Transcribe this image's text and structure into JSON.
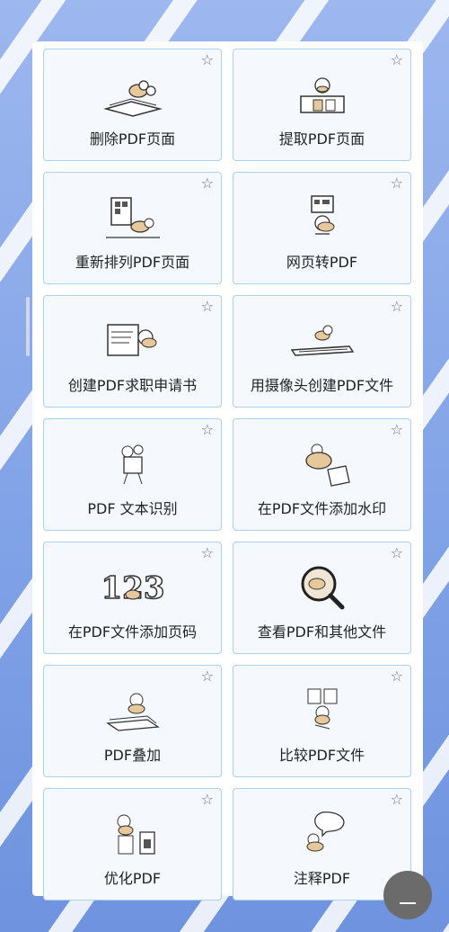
{
  "tools": [
    {
      "label": "删除PDF页面",
      "icon": "delete-pages-illustration"
    },
    {
      "label": "提取PDF页面",
      "icon": "extract-pages-illustration"
    },
    {
      "label": "重新排列PDF页面",
      "icon": "reorder-pages-illustration"
    },
    {
      "label": "网页转PDF",
      "icon": "web-to-pdf-illustration"
    },
    {
      "label": "创建PDF求职申请书",
      "icon": "resume-illustration"
    },
    {
      "label": "用摄像头创建PDF文件",
      "icon": "camera-scan-illustration"
    },
    {
      "label": "PDF 文本识别",
      "icon": "ocr-illustration"
    },
    {
      "label": "在PDF文件添加水印",
      "icon": "watermark-illustration"
    },
    {
      "label": "在PDF文件添加页码",
      "icon": "page-numbers-illustration"
    },
    {
      "label": "查看PDF和其他文件",
      "icon": "viewer-magnifier-illustration"
    },
    {
      "label": "PDF叠加",
      "icon": "overlay-illustration"
    },
    {
      "label": "比较PDF文件",
      "icon": "compare-illustration"
    },
    {
      "label": "优化PDF",
      "icon": "optimize-illustration"
    },
    {
      "label": "注释PDF",
      "icon": "annotate-illustration"
    }
  ],
  "star_icon": "☆",
  "colors": {
    "card_border": "#a9d2ec",
    "card_bg": "#f5f9fd",
    "background": "#7fa1e6"
  }
}
